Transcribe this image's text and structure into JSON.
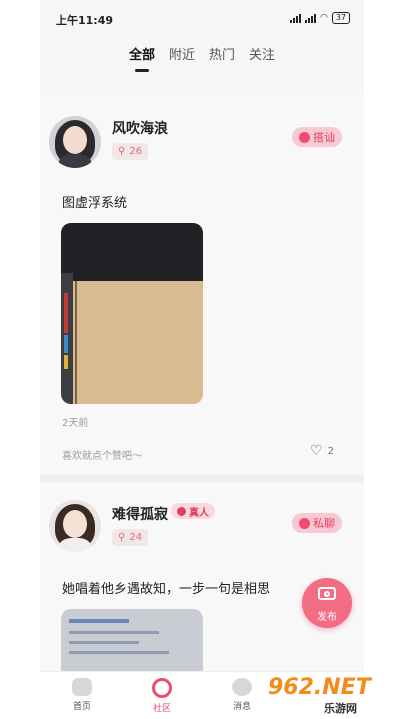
{
  "status_bar": {
    "time": "上午11:49",
    "battery": "37"
  },
  "tabs": [
    "全部",
    "附近",
    "热门",
    "关注"
  ],
  "posts": [
    {
      "username": "风吹海浪",
      "age": "26",
      "action": "搭讪",
      "text": "图虚浮系统",
      "time_ago": "2天前",
      "like_prompt": "喜欢就点个赞吧～",
      "likes": "2"
    },
    {
      "username": "难得孤寂",
      "badge": "真人",
      "age": "24",
      "action": "私聊",
      "text": "她唱着他乡遇故知，一步一句是相思"
    }
  ],
  "fab": {
    "label": "发布"
  },
  "bottom_nav": [
    {
      "label": "首页"
    },
    {
      "label": "社区"
    },
    {
      "label": "消息"
    }
  ],
  "watermark": {
    "main": "962.NET",
    "sub": "乐游网"
  },
  "colors": {
    "accent": "#ee4b6e",
    "pill_bg": "#f7c9d3"
  }
}
